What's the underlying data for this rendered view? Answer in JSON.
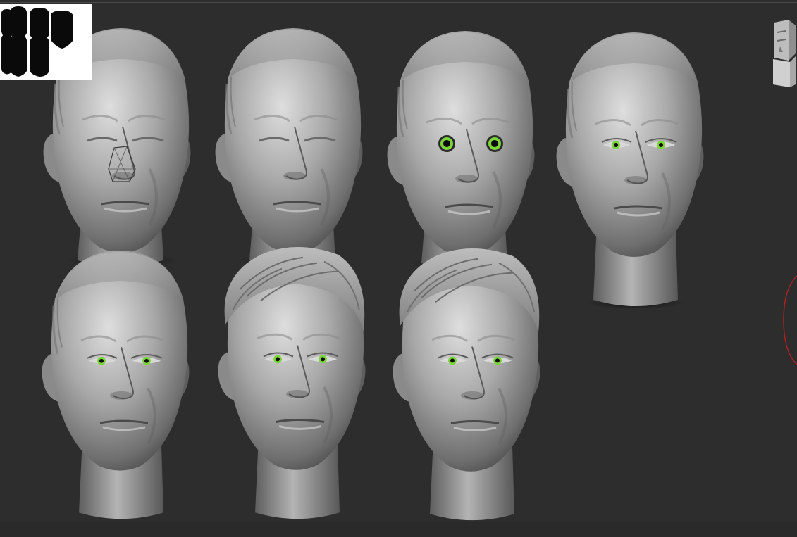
{
  "app": {
    "viewport_background": "#2d2d2d",
    "navigator_background": "#ffffff"
  },
  "heads": [
    {
      "stage": 1,
      "row": 1,
      "eyes": "closed",
      "nose": "wireframe-blockout",
      "hair": "low-relief",
      "neck": "short"
    },
    {
      "stage": 2,
      "row": 1,
      "eyes": "closed",
      "nose": "sculpted",
      "hair": "low-relief",
      "neck": "short"
    },
    {
      "stage": 3,
      "row": 1,
      "eyes": "round-open-green",
      "nose": "sculpted",
      "hair": "low-relief",
      "neck": "short"
    },
    {
      "stage": 4,
      "row": 1,
      "eyes": "almond-green",
      "nose": "sculpted",
      "hair": "low-relief",
      "neck": "long"
    },
    {
      "stage": 5,
      "row": 2,
      "eyes": "almond-green",
      "nose": "sculpted",
      "hair": "low-relief",
      "neck": "long"
    },
    {
      "stage": 6,
      "row": 2,
      "eyes": "almond-green",
      "nose": "sculpted",
      "hair": "combed-strands",
      "neck": "long"
    },
    {
      "stage": 7,
      "row": 2,
      "eyes": "almond-green",
      "nose": "sculpted",
      "hair": "combed-strands",
      "neck": "long"
    }
  ],
  "icons": {
    "navigator": "silhouette-thumbnails",
    "nav_cube": "head-orientation-cube-icon",
    "rotate": "rotation-ring-icon"
  },
  "colors": {
    "clay": "#9a9a9a",
    "iris": "#7bd43a",
    "rotate_ring": "#b02020"
  }
}
